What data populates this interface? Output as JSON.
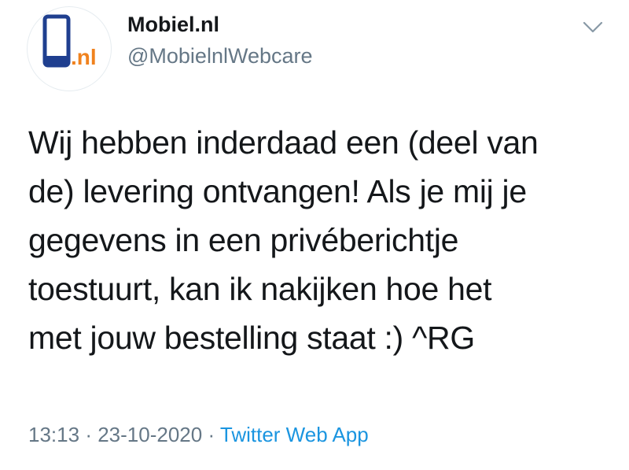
{
  "account": {
    "display_name": "Mobiel.nl",
    "handle": "@MobielnlWebcare",
    "avatar_logo_text": ".nl"
  },
  "tweet": {
    "lines": [
      "Wij hebben inderdaad een (deel van",
      "de) levering ontvangen! Als je mij je",
      "gegevens in een privéberichtje",
      "toestuurt, kan ik nakijken hoe het",
      "met jouw bestelling staat :) ^RG"
    ]
  },
  "meta": {
    "time": "13:13",
    "separator": "·",
    "date": "23-10-2020",
    "source": "Twitter Web App"
  },
  "icons": {
    "menu": "chevron-down-icon"
  },
  "colors": {
    "text": "#14171a",
    "secondary": "#657786",
    "link": "#1b95e0",
    "logo_blue": "#1f3f8f",
    "logo_orange": "#f0821e"
  }
}
